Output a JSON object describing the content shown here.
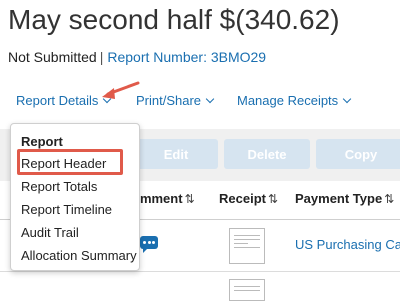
{
  "header": {
    "title": "May second half $(340.62)",
    "status": "Not Submitted",
    "separator": "|",
    "report_number": "Report Number: 3BMO29"
  },
  "nav": {
    "report_details": "Report Details",
    "print_share": "Print/Share",
    "manage_receipts": "Manage Receipts"
  },
  "toolbar": {
    "edit": "Edit",
    "delete": "Delete",
    "copy": "Copy"
  },
  "table": {
    "columns": [
      "omment",
      "Receipt",
      "Payment Type"
    ],
    "sort_glyph": "⇅",
    "rows": [
      {
        "payment_type": "US Purchasing Ca"
      }
    ]
  },
  "dropdown": {
    "heading": "Report",
    "items": [
      "Report Header",
      "Report Totals",
      "Report Timeline",
      "Audit Trail",
      "Allocation Summary"
    ],
    "highlighted_item": "Report Header"
  },
  "colors": {
    "link": "#1a6fb0",
    "annotation": "#e05a4a",
    "disabled_button": "#d6e4f0"
  },
  "icons": {
    "nav_dropdown": "chevron-down-icon",
    "comment": "comment-bubble-icon",
    "receipt": "receipt-thumbnail-icon",
    "annotation": "red-arrow-icon"
  }
}
